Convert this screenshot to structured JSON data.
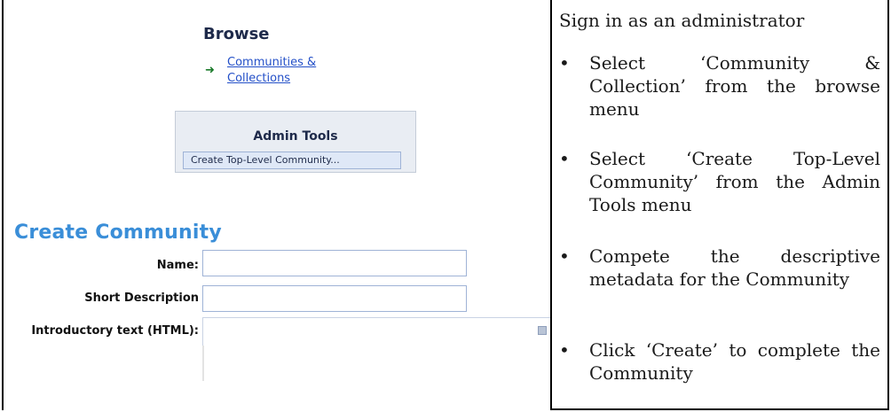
{
  "left_panel": {
    "browse": {
      "title": "Browse",
      "arrow_icon": "right-arrow",
      "link": "Communities & Collections"
    },
    "admin_tools": {
      "title": "Admin Tools",
      "button_label": "Create Top-Level Community..."
    },
    "form": {
      "heading": "Create Community",
      "fields": [
        {
          "label": "Name:",
          "value": ""
        },
        {
          "label": "Short Description",
          "value": ""
        },
        {
          "label": "Introductory text (HTML):",
          "value": ""
        }
      ]
    }
  },
  "instructions": {
    "intro": "Sign in as an administrator",
    "steps": [
      "Select ‘Community & Collection’ from the browse menu",
      "Select ‘Create Top-Level Community’ from the Admin Tools menu",
      "Compete the descriptive metadata for the Community",
      "Click ‘Create’ to complete the Community"
    ],
    "bullet": "•"
  },
  "colors": {
    "heading_blue": "#3a8ed8",
    "link_blue": "#2450c8",
    "admin_panel": "#e9edf3"
  }
}
